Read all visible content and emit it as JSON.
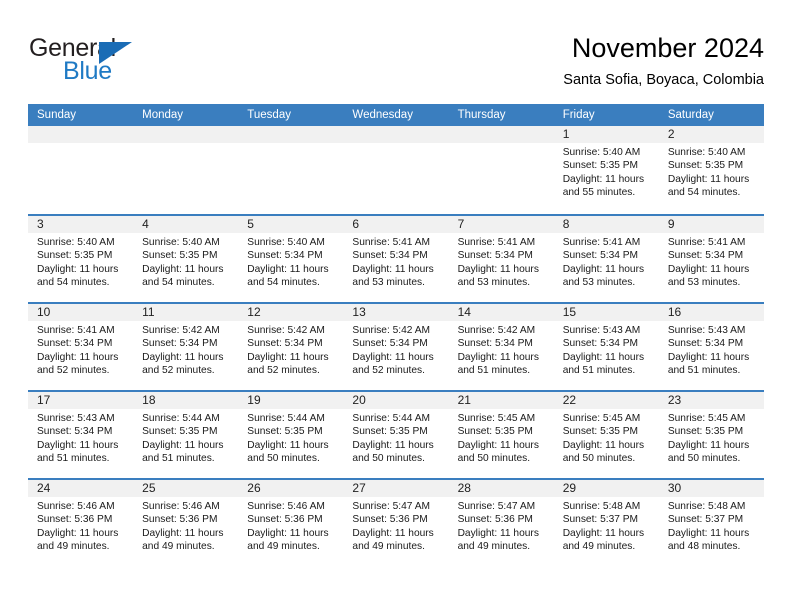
{
  "brand": {
    "name_part1": "General",
    "name_part2": "Blue",
    "logo_icon": "blue-triangle-icon"
  },
  "header": {
    "title": "November 2024",
    "subtitle": "Santa Sofia, Boyaca, Colombia"
  },
  "colors": {
    "header_blue": "#3a7ebf",
    "brand_blue": "#1f7ac4",
    "day_band_gray": "#f1f1f1",
    "cell_white": "#ffffff"
  },
  "weekdays": [
    "Sunday",
    "Monday",
    "Tuesday",
    "Wednesday",
    "Thursday",
    "Friday",
    "Saturday"
  ],
  "weeks": [
    [
      {
        "day": "",
        "empty": true
      },
      {
        "day": "",
        "empty": true
      },
      {
        "day": "",
        "empty": true
      },
      {
        "day": "",
        "empty": true
      },
      {
        "day": "",
        "empty": true
      },
      {
        "day": "1",
        "sunrise": "Sunrise: 5:40 AM",
        "sunset": "Sunset: 5:35 PM",
        "daylight1": "Daylight: 11 hours",
        "daylight2": "and 55 minutes."
      },
      {
        "day": "2",
        "sunrise": "Sunrise: 5:40 AM",
        "sunset": "Sunset: 5:35 PM",
        "daylight1": "Daylight: 11 hours",
        "daylight2": "and 54 minutes."
      }
    ],
    [
      {
        "day": "3",
        "sunrise": "Sunrise: 5:40 AM",
        "sunset": "Sunset: 5:35 PM",
        "daylight1": "Daylight: 11 hours",
        "daylight2": "and 54 minutes."
      },
      {
        "day": "4",
        "sunrise": "Sunrise: 5:40 AM",
        "sunset": "Sunset: 5:35 PM",
        "daylight1": "Daylight: 11 hours",
        "daylight2": "and 54 minutes."
      },
      {
        "day": "5",
        "sunrise": "Sunrise: 5:40 AM",
        "sunset": "Sunset: 5:34 PM",
        "daylight1": "Daylight: 11 hours",
        "daylight2": "and 54 minutes."
      },
      {
        "day": "6",
        "sunrise": "Sunrise: 5:41 AM",
        "sunset": "Sunset: 5:34 PM",
        "daylight1": "Daylight: 11 hours",
        "daylight2": "and 53 minutes."
      },
      {
        "day": "7",
        "sunrise": "Sunrise: 5:41 AM",
        "sunset": "Sunset: 5:34 PM",
        "daylight1": "Daylight: 11 hours",
        "daylight2": "and 53 minutes."
      },
      {
        "day": "8",
        "sunrise": "Sunrise: 5:41 AM",
        "sunset": "Sunset: 5:34 PM",
        "daylight1": "Daylight: 11 hours",
        "daylight2": "and 53 minutes."
      },
      {
        "day": "9",
        "sunrise": "Sunrise: 5:41 AM",
        "sunset": "Sunset: 5:34 PM",
        "daylight1": "Daylight: 11 hours",
        "daylight2": "and 53 minutes."
      }
    ],
    [
      {
        "day": "10",
        "sunrise": "Sunrise: 5:41 AM",
        "sunset": "Sunset: 5:34 PM",
        "daylight1": "Daylight: 11 hours",
        "daylight2": "and 52 minutes."
      },
      {
        "day": "11",
        "sunrise": "Sunrise: 5:42 AM",
        "sunset": "Sunset: 5:34 PM",
        "daylight1": "Daylight: 11 hours",
        "daylight2": "and 52 minutes."
      },
      {
        "day": "12",
        "sunrise": "Sunrise: 5:42 AM",
        "sunset": "Sunset: 5:34 PM",
        "daylight1": "Daylight: 11 hours",
        "daylight2": "and 52 minutes."
      },
      {
        "day": "13",
        "sunrise": "Sunrise: 5:42 AM",
        "sunset": "Sunset: 5:34 PM",
        "daylight1": "Daylight: 11 hours",
        "daylight2": "and 52 minutes."
      },
      {
        "day": "14",
        "sunrise": "Sunrise: 5:42 AM",
        "sunset": "Sunset: 5:34 PM",
        "daylight1": "Daylight: 11 hours",
        "daylight2": "and 51 minutes."
      },
      {
        "day": "15",
        "sunrise": "Sunrise: 5:43 AM",
        "sunset": "Sunset: 5:34 PM",
        "daylight1": "Daylight: 11 hours",
        "daylight2": "and 51 minutes."
      },
      {
        "day": "16",
        "sunrise": "Sunrise: 5:43 AM",
        "sunset": "Sunset: 5:34 PM",
        "daylight1": "Daylight: 11 hours",
        "daylight2": "and 51 minutes."
      }
    ],
    [
      {
        "day": "17",
        "sunrise": "Sunrise: 5:43 AM",
        "sunset": "Sunset: 5:34 PM",
        "daylight1": "Daylight: 11 hours",
        "daylight2": "and 51 minutes."
      },
      {
        "day": "18",
        "sunrise": "Sunrise: 5:44 AM",
        "sunset": "Sunset: 5:35 PM",
        "daylight1": "Daylight: 11 hours",
        "daylight2": "and 51 minutes."
      },
      {
        "day": "19",
        "sunrise": "Sunrise: 5:44 AM",
        "sunset": "Sunset: 5:35 PM",
        "daylight1": "Daylight: 11 hours",
        "daylight2": "and 50 minutes."
      },
      {
        "day": "20",
        "sunrise": "Sunrise: 5:44 AM",
        "sunset": "Sunset: 5:35 PM",
        "daylight1": "Daylight: 11 hours",
        "daylight2": "and 50 minutes."
      },
      {
        "day": "21",
        "sunrise": "Sunrise: 5:45 AM",
        "sunset": "Sunset: 5:35 PM",
        "daylight1": "Daylight: 11 hours",
        "daylight2": "and 50 minutes."
      },
      {
        "day": "22",
        "sunrise": "Sunrise: 5:45 AM",
        "sunset": "Sunset: 5:35 PM",
        "daylight1": "Daylight: 11 hours",
        "daylight2": "and 50 minutes."
      },
      {
        "day": "23",
        "sunrise": "Sunrise: 5:45 AM",
        "sunset": "Sunset: 5:35 PM",
        "daylight1": "Daylight: 11 hours",
        "daylight2": "and 50 minutes."
      }
    ],
    [
      {
        "day": "24",
        "sunrise": "Sunrise: 5:46 AM",
        "sunset": "Sunset: 5:36 PM",
        "daylight1": "Daylight: 11 hours",
        "daylight2": "and 49 minutes."
      },
      {
        "day": "25",
        "sunrise": "Sunrise: 5:46 AM",
        "sunset": "Sunset: 5:36 PM",
        "daylight1": "Daylight: 11 hours",
        "daylight2": "and 49 minutes."
      },
      {
        "day": "26",
        "sunrise": "Sunrise: 5:46 AM",
        "sunset": "Sunset: 5:36 PM",
        "daylight1": "Daylight: 11 hours",
        "daylight2": "and 49 minutes."
      },
      {
        "day": "27",
        "sunrise": "Sunrise: 5:47 AM",
        "sunset": "Sunset: 5:36 PM",
        "daylight1": "Daylight: 11 hours",
        "daylight2": "and 49 minutes."
      },
      {
        "day": "28",
        "sunrise": "Sunrise: 5:47 AM",
        "sunset": "Sunset: 5:36 PM",
        "daylight1": "Daylight: 11 hours",
        "daylight2": "and 49 minutes."
      },
      {
        "day": "29",
        "sunrise": "Sunrise: 5:48 AM",
        "sunset": "Sunset: 5:37 PM",
        "daylight1": "Daylight: 11 hours",
        "daylight2": "and 49 minutes."
      },
      {
        "day": "30",
        "sunrise": "Sunrise: 5:48 AM",
        "sunset": "Sunset: 5:37 PM",
        "daylight1": "Daylight: 11 hours",
        "daylight2": "and 48 minutes."
      }
    ]
  ]
}
